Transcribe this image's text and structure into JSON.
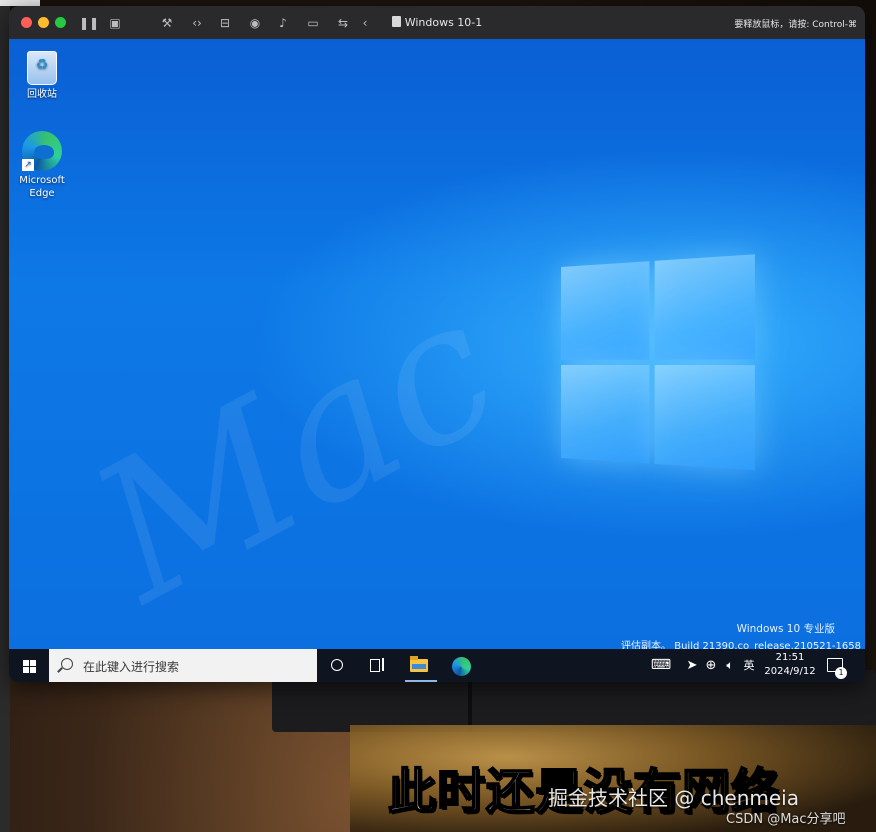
{
  "vm_window": {
    "title": "Windows 10-1",
    "hint": "要释放鼠标，请按: Control-⌘",
    "toolbar_icons": [
      "pause-icon",
      "snapshot-icon",
      "wrench-icon",
      "code-icon",
      "drive-icon",
      "camera-icon",
      "sound-icon",
      "display-icon",
      "usb-icon",
      "back-arrow-icon"
    ]
  },
  "desktop": {
    "icons": [
      {
        "label": "回收站",
        "icon": "recycle-bin-icon"
      },
      {
        "label": "Microsoft Edge",
        "icon": "edge-icon"
      }
    ],
    "eval_line1": "Windows 10 专业版",
    "eval_line2": "评估副本。 Build 21390.co_release.210521-1658"
  },
  "taskbar": {
    "search_placeholder": "在此键入进行搜索",
    "ime": "英",
    "time": "21:51",
    "date": "2024/9/12",
    "notification_count": "1"
  },
  "overlay": {
    "caption_white": "此时还是",
    "caption_yellow": "没有网络",
    "watermark_juejin": "掘金技术社区 @ chenmeia",
    "watermark_csdn": "CSDN @Mac分享吧"
  },
  "colors": {
    "desktop_blue": "#0c6fe0",
    "taskbar": "#0f1520",
    "caption_yellow": "#f7e11b"
  }
}
